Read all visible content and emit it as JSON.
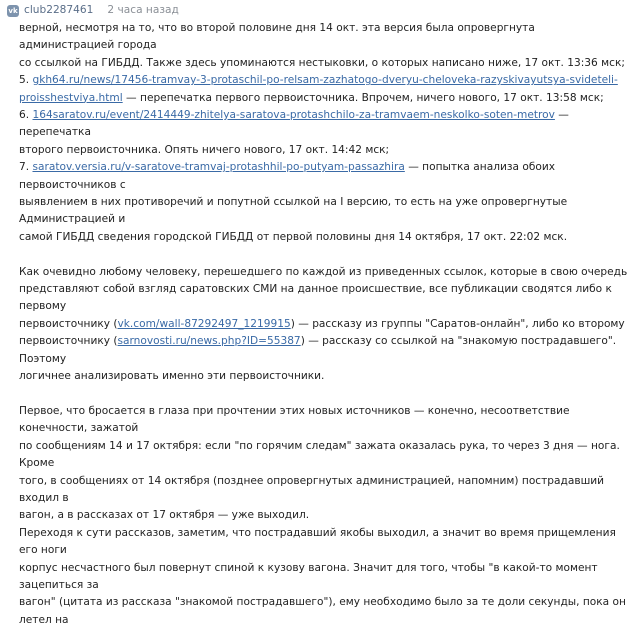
{
  "header": {
    "vk_icon": "vk-logo-icon",
    "club": "club2287461",
    "time": "2 часа назад"
  },
  "blocks": [
    [
      {
        "t": "верной, несмотря на то, что во второй половине дня 14 окт. эта версия была опровергнута администрацией города"
      },
      {
        "br": 1
      },
      {
        "t": "со ссылкой на ГИБДД. Также здесь упоминаются нестыковки, о которых написано ниже, 17 окт. 13:36 мск;"
      },
      {
        "br": 1
      },
      {
        "t": "5. "
      },
      {
        "l": "gkh64.ru/news/17456-tramvay-3-protaschil-po-relsam-zazhatogo-dveryu-cheloveka-razyskivayutsya-svideteli-"
      },
      {
        "br": 1
      },
      {
        "l": "proisshestviya.html"
      },
      {
        "t": " — перепечатка первого первоисточника. Впрочем, ничего нового, 17 окт. 13:58 мск;"
      },
      {
        "br": 1
      },
      {
        "t": "6. "
      },
      {
        "l": "164saratov.ru/event/2414449-zhitelya-saratova-protashchilo-za-tramvaem-neskolko-soten-metrov"
      },
      {
        "t": " — перепечатка"
      },
      {
        "br": 1
      },
      {
        "t": "второго первоисточника. Опять ничего нового, 17 окт. 14:42 мск;"
      },
      {
        "br": 1
      },
      {
        "t": "7. "
      },
      {
        "l": "saratov.versia.ru/v-saratove-tramvaj-protashhil-po-putyam-passazhira"
      },
      {
        "t": " — попытка анализа обоих первоисточников с"
      },
      {
        "br": 1
      },
      {
        "t": "выявлением в них противоречий и попутной ссылкой на I версию, то есть на уже опровергнутые Администрацией и"
      },
      {
        "br": 1
      },
      {
        "t": "самой ГИБДД сведения городской ГИБДД от первой половины дня 14 октября, 17 окт. 22:02 мск."
      }
    ],
    [
      {
        "t": "Как очевидно любому человеку, перешедшего по каждой из приведенных ссылок, которые в свою очередь"
      },
      {
        "br": 1
      },
      {
        "t": "представляют собой взгляд саратовских СМИ на данное происшествие, все публикации сводятся либо к первому"
      },
      {
        "br": 1
      },
      {
        "t": "первоисточнику ("
      },
      {
        "l": "vk.com/wall-87292497_1219915"
      },
      {
        "t": ") — рассказу из группы \"Саратов-онлайн\", либо ко второму"
      },
      {
        "br": 1
      },
      {
        "t": "первоисточнику ("
      },
      {
        "l": "sarnovosti.ru/news.php?ID=55387"
      },
      {
        "t": ") — рассказу со ссылкой на \"знакомую пострадавшего\". Поэтому"
      },
      {
        "br": 1
      },
      {
        "t": "логичнее анализировать именно эти первоисточники."
      }
    ],
    [
      {
        "t": "Первое, что бросается в глаза при прочтении этих новых источников — конечно, несоответствие конечности, зажатой"
      },
      {
        "br": 1
      },
      {
        "t": "по сообщениям 14 и 17 октября: если \"по горячим следам\" зажата оказалась рука, то через 3 дня — нога. Кроме"
      },
      {
        "br": 1
      },
      {
        "t": "того, в сообщениях от 14 октября (позднее опровергнутых администрацией, напомним) пострадавший входил в"
      },
      {
        "br": 1
      },
      {
        "t": "вагон, а в рассказах от 17 октября — уже выходил."
      },
      {
        "br": 1
      },
      {
        "t": "Переходя к сути рассказов, заметим, что пострадавший якобы выходил, а значит во время прищемления его ноги"
      },
      {
        "br": 1
      },
      {
        "t": "корпус несчастного был повернут спиной к кузову вагона. Значит для того, чтобы \"в какой-то момент зацепиться за"
      },
      {
        "br": 1
      },
      {
        "t": "вагон\" (цитата из рассказа \"знакомой пострадавшего\"), ему необходимо было за те доли секунды, пока он летел на"
      }
    ]
  ]
}
